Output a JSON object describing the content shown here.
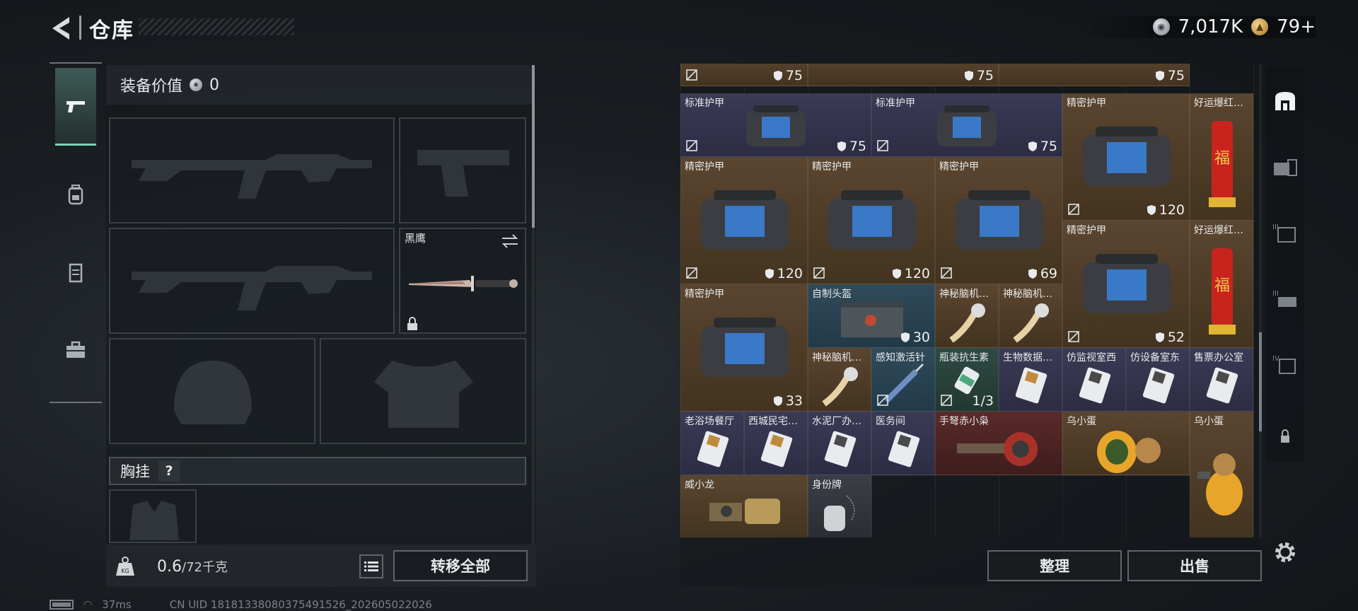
{
  "header": {
    "title": "仓库"
  },
  "currency": {
    "silver": "7,017K",
    "gold": "79+"
  },
  "left_tabs": [
    {
      "icon": "pistol-icon",
      "active": true
    },
    {
      "icon": "backpack-icon",
      "active": false
    },
    {
      "icon": "rig-icon",
      "active": false
    },
    {
      "icon": "toolbox-icon",
      "active": false
    }
  ],
  "equipment": {
    "value_label": "装备价值",
    "value": "0",
    "melee_name": "黑鹰",
    "chest_label": "胸挂",
    "help": "?"
  },
  "weight": {
    "current": "0.6",
    "max": "/72千克"
  },
  "buttons": {
    "transfer_all": "转移全部",
    "sort": "整理",
    "sell": "出售"
  },
  "status": {
    "ping": "37ms",
    "uid": "CN UID 181813380803754915​26_202605022026"
  },
  "stash": {
    "items": [
      {
        "name": "",
        "value": "75"
      },
      {
        "name": "",
        "value": "75"
      },
      {
        "name": "",
        "value": "75"
      },
      {
        "name": "标准护甲",
        "value": "75"
      },
      {
        "name": "标准护甲",
        "value": "75"
      },
      {
        "name": "精密护甲",
        "value": "120"
      },
      {
        "name": "好运爆红…",
        "value": ""
      },
      {
        "name": "精密护甲",
        "value": "120"
      },
      {
        "name": "精密护甲",
        "value": "120"
      },
      {
        "name": "精密护甲",
        "value": "69"
      },
      {
        "name": "精密护甲",
        "value": "52"
      },
      {
        "name": "好运爆红…",
        "value": ""
      },
      {
        "name": "精密护甲",
        "value": "33"
      },
      {
        "name": "自制头盔",
        "value": "30"
      },
      {
        "name": "神秘脑机…",
        "value": ""
      },
      {
        "name": "神秘脑机…",
        "value": ""
      },
      {
        "name": "神秘脑机…",
        "value": ""
      },
      {
        "name": "感知激活针",
        "value": ""
      },
      {
        "name": "瓶装抗生素",
        "value": "1/3"
      },
      {
        "name": "生物数据…",
        "value": ""
      },
      {
        "name": "仿监视室西",
        "value": ""
      },
      {
        "name": "仿设备室东",
        "value": ""
      },
      {
        "name": "售票办公室",
        "value": ""
      },
      {
        "name": "老浴场餐厅",
        "value": ""
      },
      {
        "name": "西城民宅…",
        "value": ""
      },
      {
        "name": "水泥厂办…",
        "value": ""
      },
      {
        "name": "医务间",
        "value": ""
      },
      {
        "name": "手弩赤小枭",
        "value": ""
      },
      {
        "name": "乌小蛋",
        "value": ""
      },
      {
        "name": "乌小蛋",
        "value": ""
      },
      {
        "name": "威小龙",
        "value": ""
      },
      {
        "name": "身份牌",
        "value": ""
      }
    ]
  },
  "right_tabs": [
    {
      "icon": "stash-home-icon"
    },
    {
      "icon": "stash-tab-2-icon"
    },
    {
      "icon": "stash-tab-3-icon"
    },
    {
      "icon": "stash-tab-4-icon"
    },
    {
      "icon": "stash-tab-5-icon"
    },
    {
      "icon": "lock-icon"
    }
  ],
  "colors": {
    "accent": "#7ad1b6",
    "purple": "#2c2d44",
    "gold": "#43331f",
    "blue": "#223a48"
  }
}
